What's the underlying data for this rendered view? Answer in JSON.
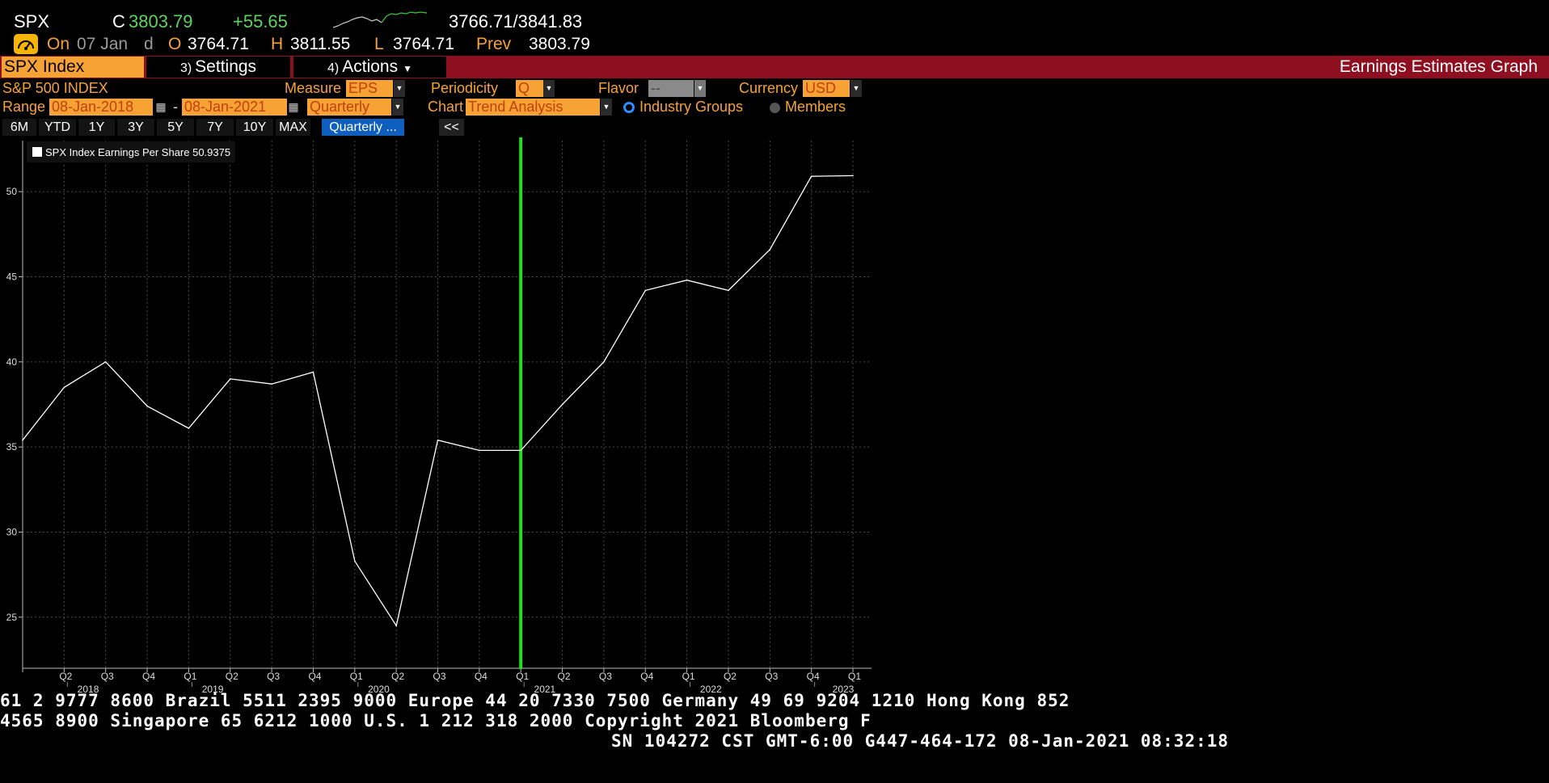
{
  "quote": {
    "ticker": "SPX",
    "last_prefix": "C",
    "last": "3803.79",
    "change": "+55.65",
    "range": "3766.71/3841.83",
    "on_label": "On",
    "date": "07 Jan",
    "d_label": "d",
    "open_label": "O",
    "open": "3764.71",
    "high_label": "H",
    "high": "3811.55",
    "low_label": "L",
    "low": "3764.71",
    "prev_label": "Prev",
    "prev": "3803.79"
  },
  "toolbar": {
    "security": "SPX Index",
    "settings_num": "3)",
    "settings_label": "Settings",
    "actions_num": "4)",
    "actions_label": "Actions",
    "function_title": "Earnings Estimates Graph"
  },
  "params": {
    "index_name": "S&P 500 INDEX",
    "measure_label": "Measure",
    "measure_value": "EPS",
    "periodicity_label": "Periodicity",
    "periodicity_value": "Q",
    "flavor_label": "Flavor",
    "flavor_value": "--",
    "currency_label": "Currency",
    "currency_value": "USD",
    "range_label": "Range",
    "range_start": "08-Jan-2018",
    "range_sep": "-",
    "range_end": "08-Jan-2021",
    "range_period": "Quarterly",
    "chart_label": "Chart",
    "chart_value": "Trend Analysis",
    "opt_industry": "Industry Groups",
    "opt_members": "Members"
  },
  "range_buttons": [
    "6M",
    "YTD",
    "1Y",
    "3Y",
    "5Y",
    "7Y",
    "10Y",
    "MAX"
  ],
  "range_selected": "Quarterly ...",
  "collapse_label": "<<",
  "chart_data": {
    "type": "line",
    "legend": "SPX Index Earnings Per Share 50.9375",
    "series": [
      {
        "name": "SPX Index Earnings Per Share",
        "values": [
          35.4,
          38.5,
          40.0,
          37.4,
          36.1,
          39.0,
          38.7,
          39.4,
          28.3,
          24.5,
          35.4,
          34.8,
          34.8,
          37.5,
          40.0,
          44.2,
          44.8,
          44.2,
          46.6,
          50.9,
          50.94
        ]
      }
    ],
    "x_quarters": [
      "",
      "Q2",
      "Q3",
      "Q4",
      "Q1",
      "Q2",
      "Q3",
      "Q4",
      "Q1",
      "Q2",
      "Q3",
      "Q4",
      "Q1",
      "Q2",
      "Q3",
      "Q4",
      "Q1",
      "Q2",
      "Q3",
      "Q4",
      "Q1"
    ],
    "years": [
      {
        "label": "2018",
        "at": 2
      },
      {
        "label": "2019",
        "at": 5
      },
      {
        "label": "2020",
        "at": 9
      },
      {
        "label": "2021",
        "at": 13
      },
      {
        "label": "2022",
        "at": 17
      },
      {
        "label": "2023",
        "at": 20
      }
    ],
    "yticks": [
      25,
      30,
      35,
      40,
      45,
      50
    ],
    "ylim": [
      22,
      53
    ],
    "current_marker_index": 12,
    "grid": true,
    "marker_color": "#22dd22",
    "line_color": "#ffffff"
  },
  "tape": {
    "line1": "61 2 9777 8600 Brazil 5511 2395 9000 Europe 44 20 7330 7500 Germany 49 69 9204 1210 Hong Kong 852",
    "line2": " 4565 8900       Singapore 65 6212 1000      U.S. 1 212 318 2000       Copyright 2021 Bloomberg F",
    "line3": "SN 104272 CST  GMT-6:00 G447-464-172 08-Jan-2021 08:32:18"
  }
}
